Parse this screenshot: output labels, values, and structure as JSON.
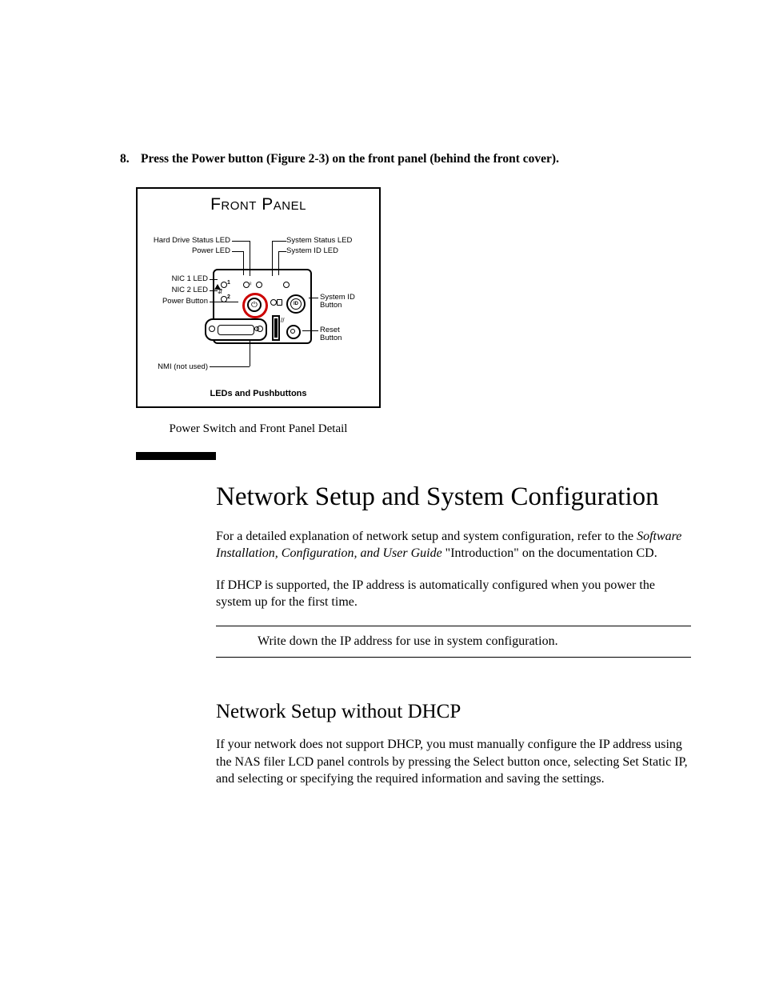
{
  "step": {
    "number": "8.",
    "text": "Press the Power button (Figure 2-3) on the front panel (behind the front cover)."
  },
  "figure": {
    "title": "Front Panel",
    "footer": "LEDs and Pushbuttons",
    "caption": "Power Switch and Front Panel Detail",
    "labels": {
      "hard_drive_status_led": "Hard Drive Status LED",
      "power_led": "Power LED",
      "nic1_led": "NIC 1 LED",
      "nic2_led": "NIC 2 LED",
      "power_button": "Power Button",
      "nmi": "NMI (not used)",
      "system_status_led": "System Status LED",
      "system_id_led": "System ID LED",
      "system_id_button": "System ID\nButton",
      "reset_button": "Reset\nButton",
      "num1": "1",
      "num2": "2",
      "id_text": "ID",
      "tick": "//"
    }
  },
  "section": {
    "heading": "Network Setup and System Configuration",
    "p1_a": "For a detailed explanation of network setup and system configuration, refer to the ",
    "p1_em": "Software Installation, Configuration, and User Guide",
    "p1_b": " \"Introduction\" on the documentation CD.",
    "p2": "If DHCP is supported, the IP address is automatically configured when you power the system up for the first time.",
    "note": "Write down the IP address for use in system configuration."
  },
  "subsection": {
    "heading": "Network Setup without DHCP",
    "p1": "If your network does not support DHCP, you must manually configure the IP address using the NAS filer LCD panel controls by pressing the Select button once, selecting Set Static IP, and selecting or specifying the required information and saving the settings."
  }
}
